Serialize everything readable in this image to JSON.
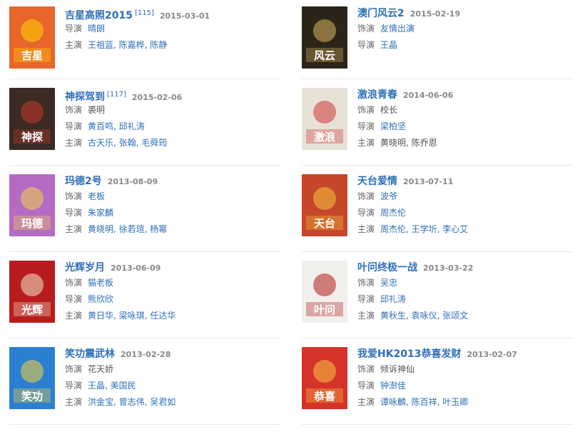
{
  "movies": [
    {
      "title": "吉星高照2015",
      "cite": "[115]",
      "date": "2015-03-01",
      "rows": [
        {
          "label": "导演",
          "value": "晴朗",
          "linked": true
        },
        {
          "label": "主演",
          "value": "王祖蓝, 陈嘉桦, 陈静",
          "linked": true
        }
      ],
      "poster": {
        "bg": "#e8662c",
        "accent": "#ffd200",
        "text": "吉星"
      }
    },
    {
      "title": "澳门风云2",
      "cite": "",
      "date": "2015-02-19",
      "rows": [
        {
          "label": "饰演",
          "value": "友情出演",
          "linked": true
        },
        {
          "label": "导演",
          "value": "王晶",
          "linked": true
        }
      ],
      "poster": {
        "bg": "#2b2419",
        "accent": "#d9b45a",
        "text": "风云"
      }
    },
    {
      "title": "神探驾到",
      "cite": "[117]",
      "date": "2015-02-06",
      "rows": [
        {
          "label": "饰演",
          "value": "裘明",
          "linked": false
        },
        {
          "label": "导演",
          "value": "黄百鸣, 邱礼涛",
          "linked": true
        },
        {
          "label": "主演",
          "value": "古天乐, 张翰, 毛舜筠",
          "linked": true
        }
      ],
      "poster": {
        "bg": "#3a2a22",
        "accent": "#c43a2a",
        "text": "神探"
      }
    },
    {
      "title": "激浪青春",
      "cite": "",
      "date": "2014-06-06",
      "rows": [
        {
          "label": "饰演",
          "value": "校长",
          "linked": false
        },
        {
          "label": "导演",
          "value": "梁柏坚",
          "linked": true
        },
        {
          "label": "主演",
          "value": "黄晓明, 陈乔恩",
          "linked": false
        }
      ],
      "poster": {
        "bg": "#e7e1d6",
        "accent": "#cf3a3a",
        "text": "激浪"
      }
    },
    {
      "title": "玛德2号",
      "cite": "",
      "date": "2013-08-09",
      "rows": [
        {
          "label": "饰演",
          "value": "老板",
          "linked": true
        },
        {
          "label": "导演",
          "value": "朱家麟",
          "linked": true
        },
        {
          "label": "主演",
          "value": "黄晓明, 徐若瑄, 杨幂",
          "linked": true
        }
      ],
      "poster": {
        "bg": "#b46bc4",
        "accent": "#f2d24a",
        "text": "玛德"
      }
    },
    {
      "title": "天台爱情",
      "cite": "",
      "date": "2013-07-11",
      "rows": [
        {
          "label": "饰演",
          "value": "波爷",
          "linked": true
        },
        {
          "label": "导演",
          "value": "周杰伦",
          "linked": true
        },
        {
          "label": "主演",
          "value": "周杰伦, 王学圻, 李心艾",
          "linked": true
        }
      ],
      "poster": {
        "bg": "#c6462a",
        "accent": "#f5c23c",
        "text": "天台"
      }
    },
    {
      "title": "光辉岁月",
      "cite": "",
      "date": "2013-06-09",
      "rows": [
        {
          "label": "饰演",
          "value": "猫老板",
          "linked": true
        },
        {
          "label": "导演",
          "value": "熊欣欣",
          "linked": true
        },
        {
          "label": "主演",
          "value": "黄日华, 梁咏琪, 任达华",
          "linked": true
        }
      ],
      "poster": {
        "bg": "#b81d1d",
        "accent": "#f0e6c8",
        "text": "光辉"
      }
    },
    {
      "title": "叶问终极一战",
      "cite": "",
      "date": "2013-03-22",
      "rows": [
        {
          "label": "饰演",
          "value": "吴忠",
          "linked": true
        },
        {
          "label": "导演",
          "value": "邱礼涛",
          "linked": true
        },
        {
          "label": "主演",
          "value": "黄秋生, 袁咏仪, 张颂文",
          "linked": true
        }
      ],
      "poster": {
        "bg": "#f2f0ec",
        "accent": "#b01c1c",
        "text": "叶问"
      }
    },
    {
      "title": "笑功震武林",
      "cite": "",
      "date": "2013-02-28",
      "rows": [
        {
          "label": "饰演",
          "value": "花天娇",
          "linked": false
        },
        {
          "label": "导演",
          "value": "王晶, 美国民",
          "linked": true
        },
        {
          "label": "主演",
          "value": "洪金宝, 曾志伟, 吴君如",
          "linked": true
        }
      ],
      "poster": {
        "bg": "#2b7fd1",
        "accent": "#f7d33b",
        "text": "笑功"
      }
    },
    {
      "title": "我爱HK2013恭喜发财",
      "cite": "",
      "date": "2013-02-07",
      "rows": [
        {
          "label": "饰演",
          "value": "倾诉神仙",
          "linked": false
        },
        {
          "label": "导演",
          "value": "钟澍佳",
          "linked": true
        },
        {
          "label": "主演",
          "value": "谭咏麟, 陈百祥, 叶玉卿",
          "linked": true
        }
      ],
      "poster": {
        "bg": "#d5322a",
        "accent": "#f5c542",
        "text": "恭喜"
      }
    }
  ]
}
